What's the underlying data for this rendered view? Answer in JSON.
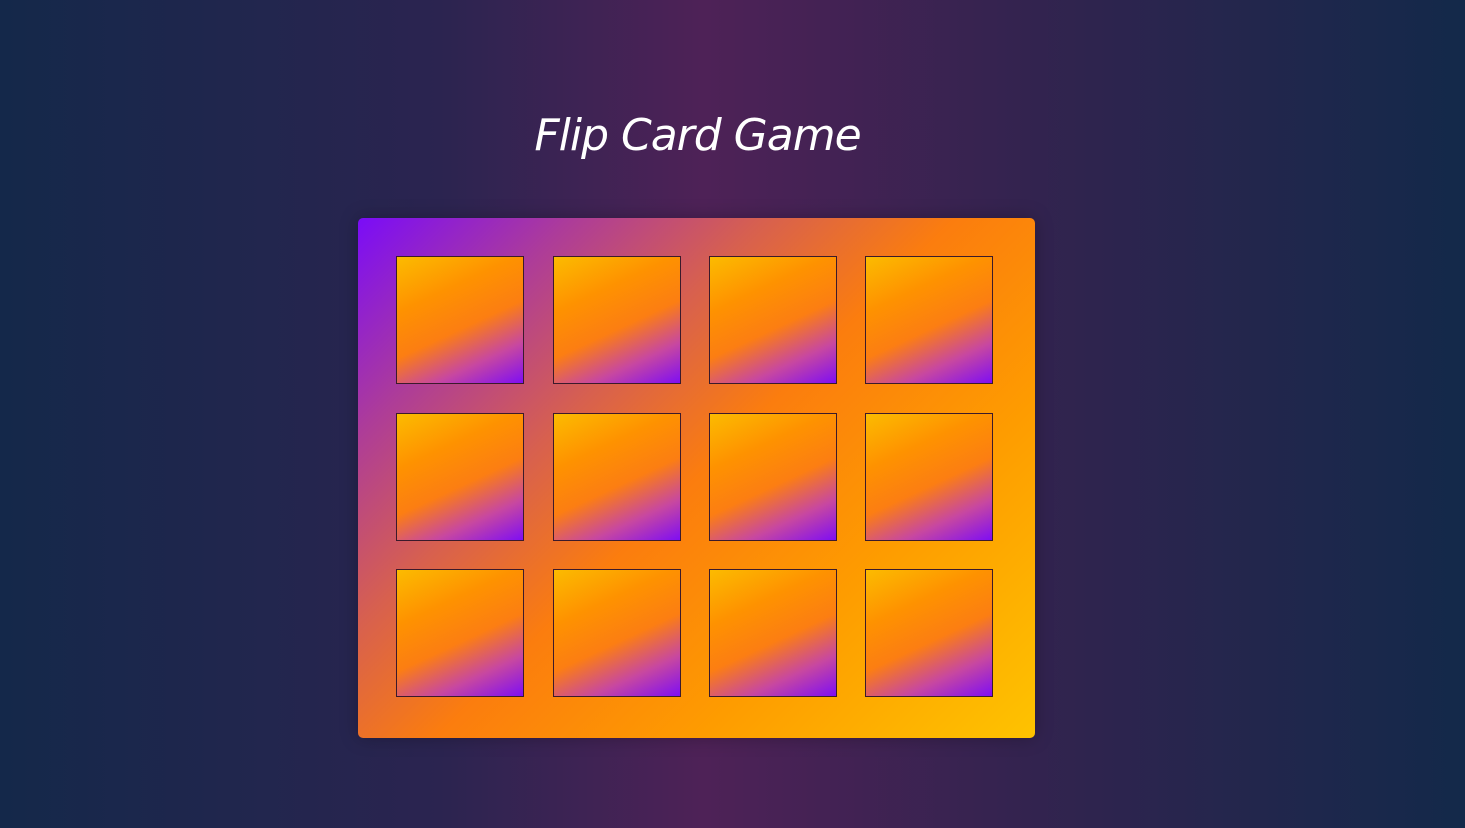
{
  "game": {
    "title": "Flip Card Game"
  },
  "board": {
    "rows": 3,
    "columns": 4,
    "cards": [
      {
        "row": 1,
        "col": 1,
        "state": "face-down"
      },
      {
        "row": 1,
        "col": 2,
        "state": "face-down"
      },
      {
        "row": 1,
        "col": 3,
        "state": "face-down"
      },
      {
        "row": 1,
        "col": 4,
        "state": "face-down"
      },
      {
        "row": 2,
        "col": 1,
        "state": "face-down"
      },
      {
        "row": 2,
        "col": 2,
        "state": "face-down"
      },
      {
        "row": 2,
        "col": 3,
        "state": "face-down"
      },
      {
        "row": 2,
        "col": 4,
        "state": "face-down"
      },
      {
        "row": 3,
        "col": 1,
        "state": "face-down"
      },
      {
        "row": 3,
        "col": 2,
        "state": "face-down"
      },
      {
        "row": 3,
        "col": 3,
        "state": "face-down"
      },
      {
        "row": 3,
        "col": 4,
        "state": "face-down"
      }
    ]
  },
  "colors": {
    "purple": "#7a0cf8",
    "orange": "#fe8a00",
    "yellow": "#fec300"
  }
}
